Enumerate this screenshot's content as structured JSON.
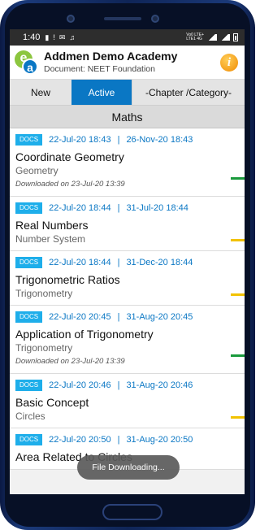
{
  "status_bar": {
    "time": "1:40",
    "network_line1": "Vo0 LTE+",
    "network_line2": "LTE1 4G"
  },
  "header": {
    "title": "Addmen Demo Academy",
    "subtitle": "Document: NEET Foundation"
  },
  "tabs": {
    "new": "New",
    "active": "Active",
    "category": "-Chapter /Category-"
  },
  "subject": "Maths",
  "items": [
    {
      "badge": "DOCS",
      "from": "22-Jul-20 18:43",
      "sep": "|",
      "to": "26-Nov-20 18:43",
      "title": "Coordinate Geometry",
      "category": "Geometry",
      "downloaded": "Downloaded on 23-Jul-20 13:39",
      "status": "green"
    },
    {
      "badge": "DOCS",
      "from": "22-Jul-20 18:44",
      "sep": "|",
      "to": "31-Jul-20 18:44",
      "title": "Real Numbers",
      "category": "Number System",
      "downloaded": "",
      "status": "yellow"
    },
    {
      "badge": "DOCS",
      "from": "22-Jul-20 18:44",
      "sep": "|",
      "to": "31-Dec-20 18:44",
      "title": "Trigonometric Ratios",
      "category": "Trigonometry",
      "downloaded": "",
      "status": "yellow"
    },
    {
      "badge": "DOCS",
      "from": "22-Jul-20 20:45",
      "sep": "|",
      "to": "31-Aug-20 20:45",
      "title": "Application of Trigonometry",
      "category": "Trigonometry",
      "downloaded": "Downloaded on 23-Jul-20 13:39",
      "status": "green"
    },
    {
      "badge": "DOCS",
      "from": "22-Jul-20 20:46",
      "sep": "|",
      "to": "31-Aug-20 20:46",
      "title": "Basic Concept",
      "category": "Circles",
      "downloaded": "",
      "status": "yellow"
    },
    {
      "badge": "DOCS",
      "from": "22-Jul-20 20:50",
      "sep": "|",
      "to": "31-Aug-20 20:50",
      "title": "Area Related to Circles",
      "category": "",
      "downloaded": "",
      "status": ""
    }
  ],
  "toast": "File Downloading...",
  "colors": {
    "accent": "#0a77c4",
    "badge": "#1eaeea",
    "green": "#1a9a3c",
    "yellow": "#f2c200"
  }
}
